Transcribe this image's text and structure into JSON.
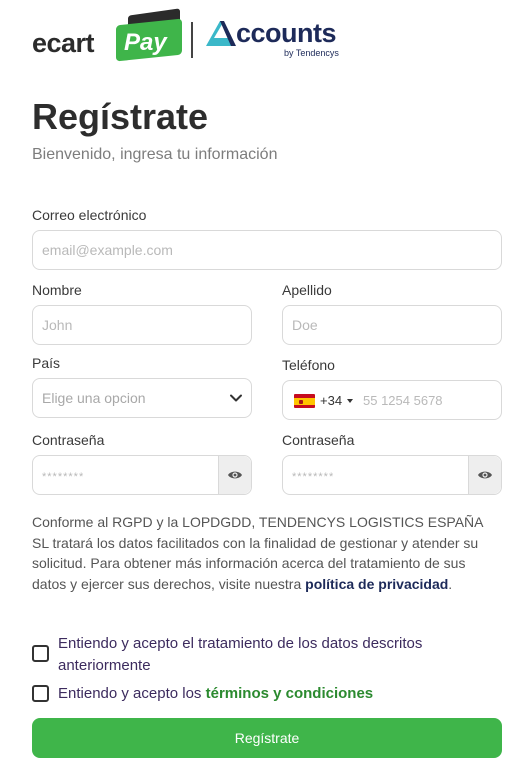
{
  "brand": {
    "ecart_text": "ecart",
    "pay_text": "Pay",
    "accounts_text": "ccounts",
    "accounts_by": "by Tendencys",
    "colors": {
      "green": "#3fb54a",
      "navy": "#1d2a59"
    }
  },
  "header": {
    "title": "Regístrate",
    "subtitle": "Bienvenido, ingresa tu información"
  },
  "form": {
    "email": {
      "label": "Correo electrónico",
      "placeholder": "email@example.com",
      "value": ""
    },
    "first_name": {
      "label": "Nombre",
      "placeholder": "John",
      "value": ""
    },
    "last_name": {
      "label": "Apellido",
      "placeholder": "Doe",
      "value": ""
    },
    "country": {
      "label": "País",
      "selected": "Elige una opcion"
    },
    "phone": {
      "label": "Teléfono",
      "dial_code": "+34",
      "placeholder": "55 1254 5678",
      "flag_icon": "spain-flag-icon"
    },
    "password": {
      "label": "Contraseña",
      "placeholder": "********",
      "icon": "eye-icon"
    },
    "password_confirm": {
      "label": "Contraseña",
      "placeholder": "********",
      "icon": "eye-icon"
    }
  },
  "notice": {
    "text": "Conforme al RGPD y la LOPDGDD, TENDENCYS LOGISTICS ESPAÑA SL tratará los datos facilitados con la finalidad de gestionar y atender su solicitud. Para obtener más información acerca del tratamiento de sus datos y ejercer sus derechos, visite nuestra ",
    "link": "política de privacidad",
    "end": "."
  },
  "consent": {
    "data_processing": "Entiendo y acepto el tratamiento de los datos descritos anteriormente",
    "terms_prefix": "Entiendo y acepto los ",
    "terms_link": "términos y condiciones"
  },
  "submit_label": "Regístrate"
}
